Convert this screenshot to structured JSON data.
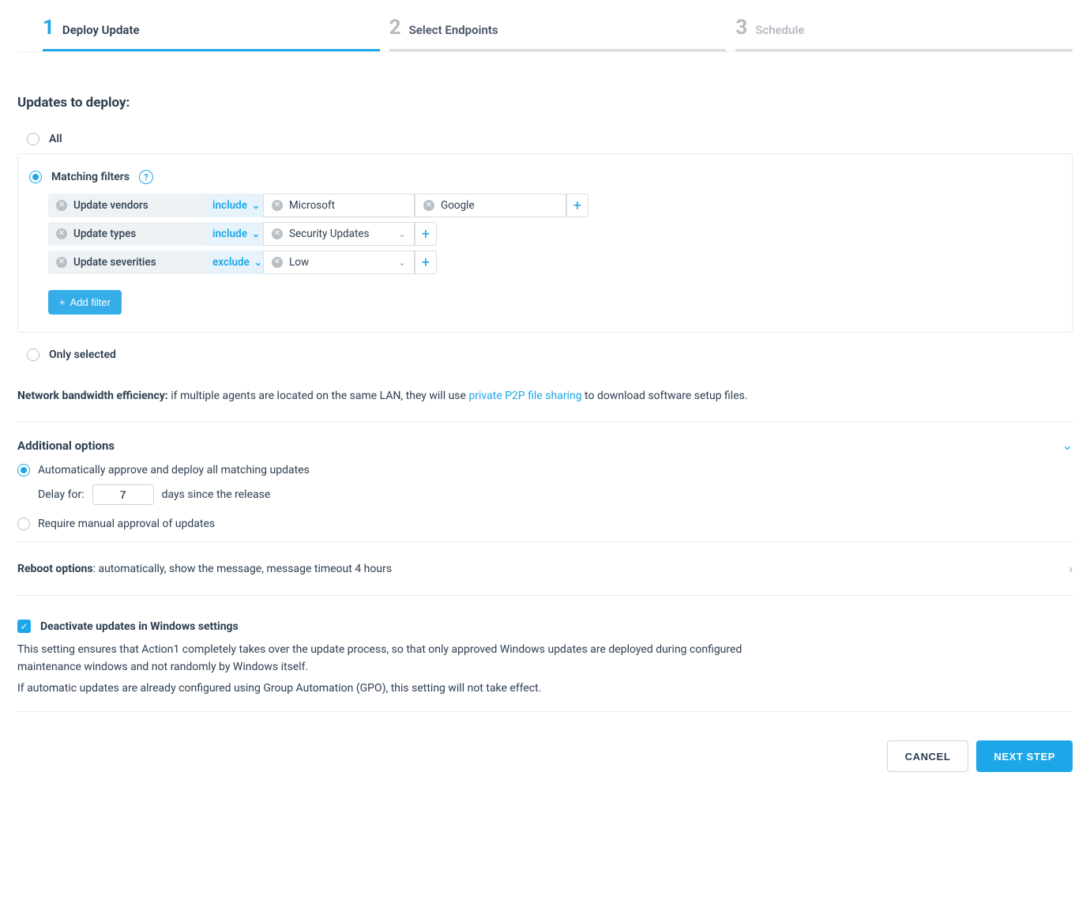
{
  "stepper": [
    {
      "num": "1",
      "label": "Deploy Update"
    },
    {
      "num": "2",
      "label": "Select Endpoints"
    },
    {
      "num": "3",
      "label": "Schedule"
    }
  ],
  "section_title": "Updates to deploy:",
  "updates_mode": {
    "all": "All",
    "matching": "Matching filters",
    "only_selected": "Only selected"
  },
  "filters": [
    {
      "name": "Update vendors",
      "mode": "include",
      "chips": [
        {
          "label": "Microsoft",
          "type": "text"
        },
        {
          "label": "Google",
          "type": "text"
        }
      ]
    },
    {
      "name": "Update types",
      "mode": "include",
      "chips": [
        {
          "label": "Security Updates",
          "type": "select"
        }
      ]
    },
    {
      "name": "Update severities",
      "mode": "exclude",
      "chips": [
        {
          "label": "Low",
          "type": "select"
        }
      ]
    }
  ],
  "add_filter_label": "Add filter",
  "network_line": {
    "bold": "Network bandwidth efficiency:",
    "pre": " if multiple agents are located on the same LAN, they will use ",
    "link": "private P2P file sharing",
    "post": " to download software setup files."
  },
  "additional_options_title": "Additional options",
  "approval": {
    "auto_label": "Automatically approve and deploy all matching updates",
    "delay_pre": "Delay for:",
    "delay_value": "7",
    "delay_post": "days since the release",
    "manual_label": "Require manual approval of updates"
  },
  "reboot": {
    "bold": "Reboot options",
    "rest": ": automatically, show the message, message timeout 4 hours"
  },
  "deactivate": {
    "label": "Deactivate updates in Windows settings",
    "desc1": "This setting ensures that Action1 completely takes over the update process, so that only approved Windows updates are deployed during configured maintenance windows and not randomly by Windows itself.",
    "desc2": "If automatic updates are already configured using Group Automation (GPO), this setting will not take effect."
  },
  "buttons": {
    "cancel": "CANCEL",
    "next": "NEXT STEP"
  }
}
